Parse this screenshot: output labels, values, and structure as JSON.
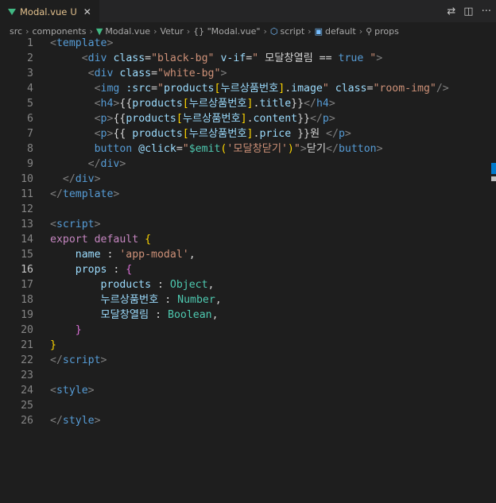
{
  "tab": {
    "filename": "Modal.vue",
    "modified": "U",
    "close": "✕"
  },
  "actions": {
    "compare": "⇄",
    "split": "◫",
    "more": "···"
  },
  "breadcrumb": [
    "src",
    "components",
    "Modal.vue",
    "Vetur",
    "{} \"Modal.vue\"",
    "script",
    "default",
    "props"
  ],
  "lines": [
    {
      "n": "1",
      "tokens": [
        [
          "t",
          "<"
        ],
        [
          "tg",
          "template"
        ],
        [
          "t",
          ">"
        ]
      ]
    },
    {
      "n": "2",
      "tokens": [
        [
          "pl",
          "     "
        ],
        [
          "t",
          "<"
        ],
        [
          "tg",
          "div"
        ],
        [
          "pl",
          " "
        ],
        [
          "at",
          "class"
        ],
        [
          "pl",
          "="
        ],
        [
          "st",
          "\"black-bg\""
        ],
        [
          "pl",
          " "
        ],
        [
          "at",
          "v-if"
        ],
        [
          "pl",
          "="
        ],
        [
          "st",
          "\""
        ],
        [
          "pl",
          " 모달창열림 "
        ],
        [
          "pl",
          "=="
        ],
        [
          "pl",
          " "
        ],
        [
          "tg",
          "true"
        ],
        [
          "pl",
          " "
        ],
        [
          "st",
          "\""
        ],
        [
          "t",
          ">"
        ]
      ]
    },
    {
      "n": "3",
      "tokens": [
        [
          "pl",
          "      "
        ],
        [
          "t",
          "<"
        ],
        [
          "tg",
          "div"
        ],
        [
          "pl",
          " "
        ],
        [
          "at",
          "class"
        ],
        [
          "pl",
          "="
        ],
        [
          "st",
          "\"white-bg\""
        ],
        [
          "t",
          ">"
        ]
      ]
    },
    {
      "n": "4",
      "tokens": [
        [
          "pl",
          "       "
        ],
        [
          "t",
          "<"
        ],
        [
          "tg",
          "img"
        ],
        [
          "pl",
          " "
        ],
        [
          "at",
          ":src"
        ],
        [
          "pl",
          "="
        ],
        [
          "st",
          "\""
        ],
        [
          "at",
          "products"
        ],
        [
          "br1",
          "["
        ],
        [
          "at",
          "누르상품번호"
        ],
        [
          "br1",
          "]"
        ],
        [
          "pl",
          "."
        ],
        [
          "at",
          "image"
        ],
        [
          "st",
          "\""
        ],
        [
          "pl",
          " "
        ],
        [
          "at",
          "class"
        ],
        [
          "pl",
          "="
        ],
        [
          "st",
          "\"room-img\""
        ],
        [
          "t",
          "/>"
        ]
      ]
    },
    {
      "n": "5",
      "tokens": [
        [
          "pl",
          "       "
        ],
        [
          "t",
          "<"
        ],
        [
          "tg",
          "h4"
        ],
        [
          "t",
          ">"
        ],
        [
          "pl",
          "{{"
        ],
        [
          "at",
          "products"
        ],
        [
          "br1",
          "["
        ],
        [
          "at",
          "누르상품번호"
        ],
        [
          "br1",
          "]"
        ],
        [
          "pl",
          "."
        ],
        [
          "at",
          "title"
        ],
        [
          "pl",
          "}}"
        ],
        [
          "t",
          "</"
        ],
        [
          "tg",
          "h4"
        ],
        [
          "t",
          ">"
        ]
      ]
    },
    {
      "n": "6",
      "tokens": [
        [
          "pl",
          "       "
        ],
        [
          "t",
          "<"
        ],
        [
          "tg",
          "p"
        ],
        [
          "t",
          ">"
        ],
        [
          "pl",
          "{{"
        ],
        [
          "at",
          "products"
        ],
        [
          "br1",
          "["
        ],
        [
          "at",
          "누르상품번호"
        ],
        [
          "br1",
          "]"
        ],
        [
          "pl",
          "."
        ],
        [
          "at",
          "content"
        ],
        [
          "pl",
          "}}"
        ],
        [
          "t",
          "</"
        ],
        [
          "tg",
          "p"
        ],
        [
          "t",
          ">"
        ]
      ]
    },
    {
      "n": "7",
      "tokens": [
        [
          "pl",
          "       "
        ],
        [
          "t",
          "<"
        ],
        [
          "tg",
          "p"
        ],
        [
          "t",
          ">"
        ],
        [
          "pl",
          "{{ "
        ],
        [
          "at",
          "products"
        ],
        [
          "br1",
          "["
        ],
        [
          "at",
          "누르상품번호"
        ],
        [
          "br1",
          "]"
        ],
        [
          "pl",
          "."
        ],
        [
          "at",
          "price"
        ],
        [
          "pl",
          " }}원 "
        ],
        [
          "t",
          "</"
        ],
        [
          "tg",
          "p"
        ],
        [
          "t",
          ">"
        ]
      ]
    },
    {
      "n": "8",
      "tokens": [
        [
          "pl",
          "       "
        ],
        [
          "tg",
          "button"
        ],
        [
          "pl",
          " "
        ],
        [
          "at",
          "@click"
        ],
        [
          "pl",
          "="
        ],
        [
          "st",
          "\""
        ],
        [
          "ty",
          "$emit"
        ],
        [
          "br1",
          "("
        ],
        [
          "st",
          "'모달창닫기'"
        ],
        [
          "br1",
          ")"
        ],
        [
          "st",
          "\""
        ],
        [
          "t",
          ">"
        ],
        [
          "pl",
          "닫기"
        ],
        [
          "t",
          "</"
        ],
        [
          "tg",
          "button"
        ],
        [
          "t",
          ">"
        ]
      ]
    },
    {
      "n": "9",
      "tokens": [
        [
          "pl",
          "      "
        ],
        [
          "t",
          "</"
        ],
        [
          "tg",
          "div"
        ],
        [
          "t",
          ">"
        ]
      ]
    },
    {
      "n": "10",
      "tokens": [
        [
          "pl",
          "  "
        ],
        [
          "t",
          "</"
        ],
        [
          "tg",
          "div"
        ],
        [
          "t",
          ">"
        ]
      ]
    },
    {
      "n": "11",
      "tokens": [
        [
          "t",
          "</"
        ],
        [
          "tg",
          "template"
        ],
        [
          "t",
          ">"
        ]
      ]
    },
    {
      "n": "12",
      "tokens": []
    },
    {
      "n": "13",
      "tokens": [
        [
          "t",
          "<"
        ],
        [
          "tg",
          "script"
        ],
        [
          "t",
          ">"
        ]
      ]
    },
    {
      "n": "14",
      "tokens": [
        [
          "kw",
          "export"
        ],
        [
          "pl",
          " "
        ],
        [
          "kw",
          "default"
        ],
        [
          "pl",
          " "
        ],
        [
          "br1",
          "{"
        ]
      ]
    },
    {
      "n": "15",
      "tokens": [
        [
          "pl",
          "    "
        ],
        [
          "at",
          "name"
        ],
        [
          "pl",
          " : "
        ],
        [
          "st",
          "'app-modal'"
        ],
        [
          "pl",
          ","
        ]
      ]
    },
    {
      "n": "16",
      "tokens": [
        [
          "pl",
          "    "
        ],
        [
          "at",
          "props"
        ],
        [
          "pl",
          " : "
        ],
        [
          "br2",
          "{"
        ]
      ]
    },
    {
      "n": "17",
      "tokens": [
        [
          "pl",
          "        "
        ],
        [
          "at",
          "products"
        ],
        [
          "pl",
          " : "
        ],
        [
          "ty",
          "Object"
        ],
        [
          "pl",
          ","
        ]
      ]
    },
    {
      "n": "18",
      "tokens": [
        [
          "pl",
          "        "
        ],
        [
          "at",
          "누르상품번호"
        ],
        [
          "pl",
          " : "
        ],
        [
          "ty",
          "Number"
        ],
        [
          "pl",
          ","
        ]
      ]
    },
    {
      "n": "19",
      "tokens": [
        [
          "pl",
          "        "
        ],
        [
          "at",
          "모달창열림"
        ],
        [
          "pl",
          " : "
        ],
        [
          "ty",
          "Boolean"
        ],
        [
          "pl",
          ","
        ]
      ]
    },
    {
      "n": "20",
      "tokens": [
        [
          "pl",
          "    "
        ],
        [
          "br2",
          "}"
        ]
      ]
    },
    {
      "n": "21",
      "tokens": [
        [
          "br1",
          "}"
        ]
      ]
    },
    {
      "n": "22",
      "tokens": [
        [
          "t",
          "</"
        ],
        [
          "tg",
          "script"
        ],
        [
          "t",
          ">"
        ]
      ]
    },
    {
      "n": "23",
      "tokens": []
    },
    {
      "n": "24",
      "tokens": [
        [
          "t",
          "<"
        ],
        [
          "tg",
          "style"
        ],
        [
          "t",
          ">"
        ]
      ]
    },
    {
      "n": "25",
      "tokens": []
    },
    {
      "n": "26",
      "tokens": [
        [
          "t",
          "</"
        ],
        [
          "tg",
          "style"
        ],
        [
          "t",
          ">"
        ]
      ]
    }
  ],
  "active_line": "16"
}
